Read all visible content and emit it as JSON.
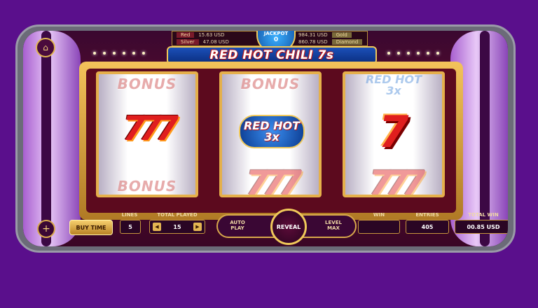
{
  "header": {
    "jackpot_label": "JACKPOT",
    "jackpot_value": "0",
    "jackpots": [
      {
        "name": "Red",
        "value": "15.63 USD"
      },
      {
        "name": "Silver",
        "value": "47.08 USD"
      },
      {
        "name": "Gold",
        "value": "984.31 USD"
      },
      {
        "name": "Diamond",
        "value": "860.78 USD"
      }
    ],
    "title": "RED HOT CHILI 7s"
  },
  "reels": [
    {
      "top": "BONUS",
      "middle": "777",
      "bottom": "BONUS"
    },
    {
      "top": "BONUS",
      "middle": "RED HOT 3x",
      "bottom": "777"
    },
    {
      "top": "RED HOT 3x",
      "middle": "7",
      "bottom": "777"
    }
  ],
  "reel_symbols": {
    "bonus": "BONUS",
    "seven_triple": "777",
    "seven": "7",
    "redhot_line1": "RED HOT",
    "redhot_line2": "3x"
  },
  "controls": {
    "buy_time": "BUY TIME",
    "lines_label": "LINES",
    "lines_value": "5",
    "total_played_label": "TOTAL PLAYED",
    "total_played_value": "15",
    "auto_play": "AUTO PLAY",
    "reveal": "REVEAL",
    "level_max": "LEVEL MAX",
    "win_label": "WIN",
    "win_value": "",
    "entries_label": "ENTRIES",
    "entries_value": "405",
    "total_win_label": "TOTAL WIN",
    "total_win_value": "00.85 USD"
  },
  "icons": {
    "home": "home-icon",
    "plus": "plus-icon",
    "minus": "minus-icon"
  },
  "colors": {
    "background": "#5a0f8c",
    "gold": "#f0c85a",
    "red": "#e01e1e",
    "blue": "#1b4fb8"
  }
}
